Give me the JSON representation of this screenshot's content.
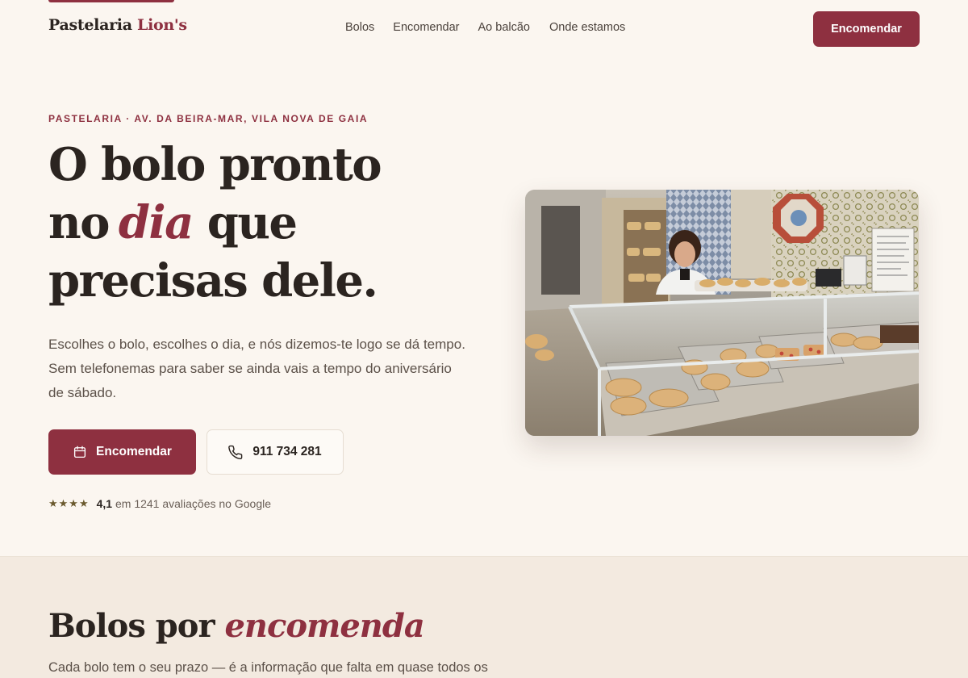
{
  "brand": {
    "name": "Pastelaria",
    "accent": "Lion's"
  },
  "nav": {
    "items": [
      {
        "label": "Bolos"
      },
      {
        "label": "Encomendar"
      },
      {
        "label": "Ao balcão"
      },
      {
        "label": "Onde estamos"
      }
    ],
    "cta_label": "Encomendar"
  },
  "hero": {
    "eyebrow": "PASTELARIA · AV. DA BEIRA-MAR, VILA NOVA DE GAIA",
    "title_line1": "O bolo pronto",
    "title_line2_pre": "no",
    "title_line2_em": "dia",
    "title_line2_post": "que",
    "title_line3": "precisas dele.",
    "description": "Escolhes o bolo, escolhes o dia, e nós dizemos-te logo se dá tempo. Sem telefonemas para saber se ainda vais a tempo do aniversário de sábado.",
    "primary_button": {
      "label": "Encomendar",
      "icon": "calendar-icon"
    },
    "secondary_button": {
      "label": "911 734 281",
      "icon": "phone-icon"
    },
    "rating": {
      "stars": "★★★★",
      "score": "4,1",
      "text": "em 1241 avaliações no Google"
    }
  },
  "section_cakes": {
    "title_pre": "Bolos por",
    "title_em": "encomenda",
    "description": "Cada bolo tem o seu prazo — é a informação que falta em quase todos os"
  },
  "colors": {
    "accent": "#8e3040",
    "background": "#fbf6f0",
    "section_background": "#f3eae0",
    "text": "#2b2420"
  }
}
